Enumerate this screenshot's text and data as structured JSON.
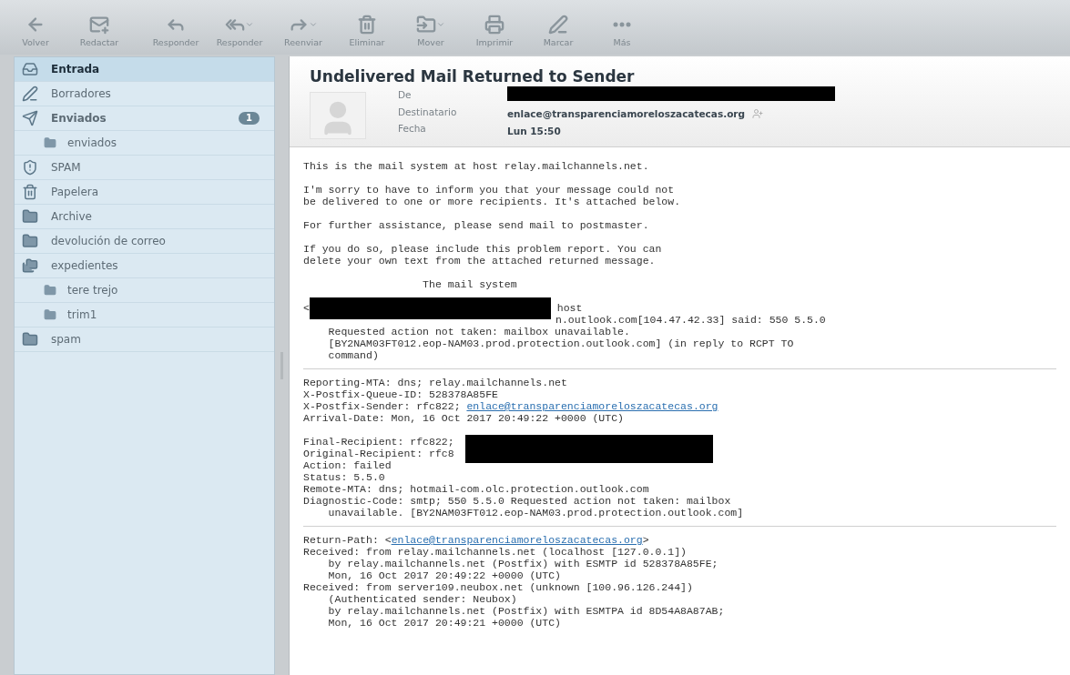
{
  "toolbar": [
    {
      "label": "Volver",
      "dropdown": false
    },
    {
      "label": "Redactar",
      "dropdown": false
    },
    {
      "label": "Responder",
      "dropdown": false
    },
    {
      "label": "Responder",
      "dropdown": true
    },
    {
      "label": "Reenviar",
      "dropdown": true
    },
    {
      "label": "Eliminar",
      "dropdown": false
    },
    {
      "label": "Mover",
      "dropdown": true
    },
    {
      "label": "Imprimir",
      "dropdown": false
    },
    {
      "label": "Marcar",
      "dropdown": false
    },
    {
      "label": "Más",
      "dropdown": false
    }
  ],
  "folders": [
    {
      "label": "Entrada",
      "selected": true,
      "bold": true
    },
    {
      "label": "Borradores",
      "selected": false,
      "bold": false
    },
    {
      "label": "Enviados",
      "selected": false,
      "bold": true,
      "count": "1",
      "children": [
        {
          "label": "enviados",
          "selected": false,
          "bold": false
        }
      ]
    },
    {
      "label": "SPAM",
      "selected": false,
      "bold": false
    },
    {
      "label": "Papelera",
      "selected": false,
      "bold": false
    },
    {
      "label": "Archive",
      "selected": false,
      "bold": false
    },
    {
      "label": "devolución de correo",
      "selected": false,
      "bold": false
    },
    {
      "label": "expedientes",
      "selected": false,
      "bold": false,
      "children": [
        {
          "label": "tere trejo",
          "selected": false,
          "bold": false
        },
        {
          "label": "trim1",
          "selected": false,
          "bold": false
        }
      ]
    },
    {
      "label": "spam",
      "selected": false,
      "bold": false
    }
  ],
  "message": {
    "subject": "Undelivered Mail Returned to Sender",
    "fields": [
      {
        "label": "De",
        "kind": "redacted"
      },
      {
        "label": "Destinatario",
        "kind": "text",
        "value": "enlace@transparenciamoreloszacatecas.org"
      },
      {
        "label": "Fecha",
        "kind": "text",
        "value": "Lun 15:50"
      }
    ],
    "sections": [
      [
        {
          "kind": "text",
          "text": "This is the mail system at host relay.mailchannels.net."
        },
        {
          "kind": "blank"
        },
        {
          "kind": "text",
          "text": "I'm sorry to have to inform you that your message could not"
        },
        {
          "kind": "text",
          "text": "be delivered to one or more recipients. It's attached below."
        },
        {
          "kind": "blank"
        },
        {
          "kind": "text",
          "text": "For further assistance, please send mail to postmaster."
        },
        {
          "kind": "blank"
        },
        {
          "kind": "text",
          "text": "If you do so, please include this problem report. You can"
        },
        {
          "kind": "text",
          "text": "delete your own text from the attached returned message."
        },
        {
          "kind": "blank"
        },
        {
          "kind": "text",
          "text": "                   The mail system"
        },
        {
          "kind": "blank"
        },
        {
          "kind": "redacted",
          "text": "<",
          "after": " host"
        },
        {
          "kind": "after_redaction",
          "text": "n.outlook.com[104.47.42.33] said: 550 5.5.0"
        },
        {
          "kind": "text",
          "text": "    Requested action not taken: mailbox unavailable."
        },
        {
          "kind": "text",
          "text": "    [BY2NAM03FT012.eop-NAM03.prod.protection.outlook.com] (in reply to RCPT TO"
        },
        {
          "kind": "text",
          "text": "    command)"
        }
      ],
      [
        {
          "kind": "text",
          "text": "Reporting-MTA: dns; relay.mailchannels.net"
        },
        {
          "kind": "text",
          "text": "X-Postfix-Queue-ID: 528378A85FE"
        },
        {
          "kind": "link",
          "text": "X-Postfix-Sender: rfc822; ",
          "link": "enlace@transparenciamoreloszacatecas.org"
        },
        {
          "kind": "text",
          "text": "Arrival-Date: Mon, 16 Oct 2017 20:49:22 +0000 (UTC)"
        },
        {
          "kind": "blank"
        },
        {
          "kind": "redacted_wide",
          "text": "Final-Recipient: rfc822;"
        },
        {
          "kind": "text",
          "text": "Original-Recipient: rfc8"
        },
        {
          "kind": "text",
          "text": "Action: failed"
        },
        {
          "kind": "text",
          "text": "Status: 5.5.0"
        },
        {
          "kind": "text",
          "text": "Remote-MTA: dns; hotmail-com.olc.protection.outlook.com"
        },
        {
          "kind": "text",
          "text": "Diagnostic-Code: smtp; 550 5.5.0 Requested action not taken: mailbox"
        },
        {
          "kind": "text",
          "text": "    unavailable. [BY2NAM03FT012.eop-NAM03.prod.protection.outlook.com]"
        }
      ],
      [
        {
          "kind": "link",
          "text": "Return-Path: <",
          "link": "enlace@transparenciamoreloszacatecas.org",
          "after": ">"
        },
        {
          "kind": "text",
          "text": "Received: from relay.mailchannels.net (localhost [127.0.0.1])"
        },
        {
          "kind": "text",
          "text": "    by relay.mailchannels.net (Postfix) with ESMTP id 528378A85FE;"
        },
        {
          "kind": "text",
          "text": "    Mon, 16 Oct 2017 20:49:22 +0000 (UTC)"
        },
        {
          "kind": "text",
          "text": "Received: from server109.neubox.net (unknown [100.96.126.244])"
        },
        {
          "kind": "text",
          "text": "    (Authenticated sender: Neubox)"
        },
        {
          "kind": "text",
          "text": "    by relay.mailchannels.net (Postfix) with ESMTPA id 8D54A8A87AB;"
        },
        {
          "kind": "text",
          "text": "    Mon, 16 Oct 2017 20:49:21 +0000 (UTC)"
        }
      ]
    ]
  }
}
